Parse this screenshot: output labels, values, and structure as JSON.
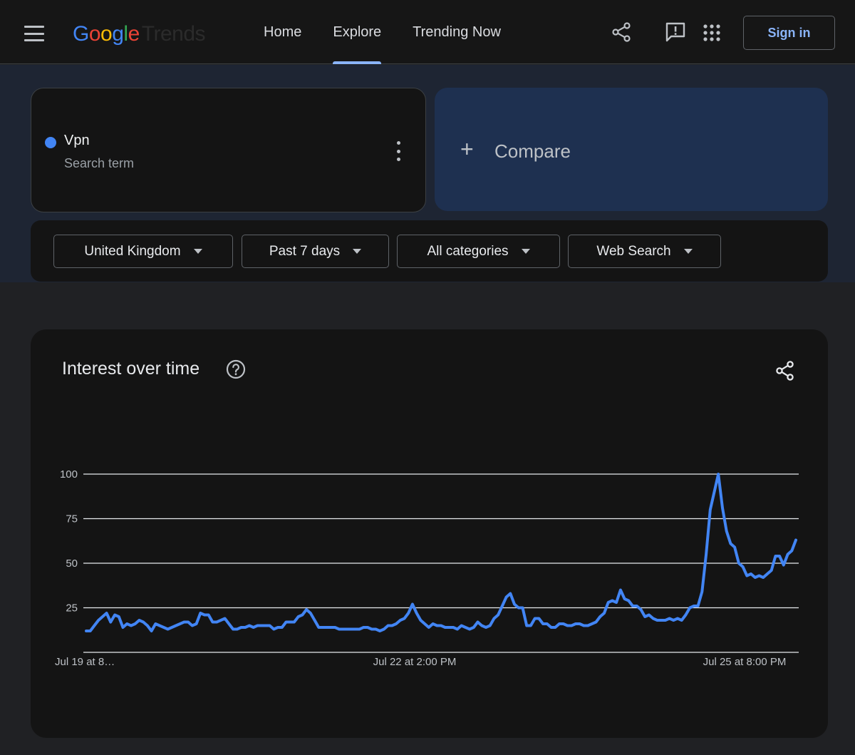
{
  "header": {
    "logo_google": "Google",
    "logo_trends": "Trends",
    "nav": [
      "Home",
      "Explore",
      "Trending Now"
    ],
    "active_nav": "Explore",
    "sign_in": "Sign in",
    "icons": [
      "menu-icon",
      "share-icon",
      "feedback-icon",
      "apps-icon"
    ]
  },
  "search_term": {
    "name": "Vpn",
    "type": "Search term",
    "color": "#4285f4"
  },
  "compare": {
    "label": "Compare"
  },
  "filters": {
    "region": "United Kingdom",
    "period": "Past 7 days",
    "category": "All categories",
    "property": "Web Search"
  },
  "chart": {
    "title": "Interest over time"
  },
  "chart_data": {
    "type": "line",
    "series": [
      {
        "name": "Vpn",
        "color": "#4285f4",
        "values": [
          12,
          12,
          15,
          18,
          20,
          22,
          17,
          21,
          20,
          14,
          16,
          15,
          16,
          18,
          17,
          15,
          12,
          16,
          15,
          14,
          13,
          14,
          15,
          16,
          17,
          17,
          15,
          16,
          22,
          21,
          21,
          17,
          17,
          18,
          19,
          16,
          13,
          13,
          14,
          14,
          15,
          14,
          15,
          15,
          15,
          15,
          13,
          14,
          14,
          17,
          17,
          17,
          20,
          21,
          24,
          22,
          18,
          14,
          14,
          14,
          14,
          14,
          13,
          13,
          13,
          13,
          13,
          13,
          14,
          14,
          13,
          13,
          12,
          13,
          15,
          15,
          16,
          18,
          19,
          22,
          27,
          22,
          18,
          16,
          14,
          16,
          15,
          15,
          14,
          14,
          14,
          13,
          15,
          14,
          13,
          14,
          17,
          15,
          14,
          15,
          19,
          21,
          26,
          31,
          33,
          27,
          25,
          25,
          15,
          15,
          19,
          19,
          16,
          16,
          14,
          14,
          16,
          16,
          15,
          15,
          16,
          16,
          15,
          15,
          16,
          17,
          20,
          22,
          28,
          29,
          28,
          35,
          30,
          29,
          26,
          26,
          24,
          20,
          21,
          19,
          18,
          18,
          18,
          19,
          18,
          19,
          18,
          21,
          25,
          26,
          26,
          34,
          55,
          80,
          90,
          100,
          81,
          68,
          61,
          59,
          50,
          48,
          43,
          44,
          42,
          43,
          42,
          44,
          46,
          54,
          54,
          49,
          55,
          57,
          63
        ]
      }
    ],
    "x_tick_labels": [
      "Jul 19 at 8…",
      "Jul 22 at 2:00 PM",
      "Jul 25 at 8:00 PM"
    ],
    "y_ticks": [
      25,
      50,
      75,
      100
    ],
    "ylim": [
      0,
      100
    ],
    "grid": true
  }
}
